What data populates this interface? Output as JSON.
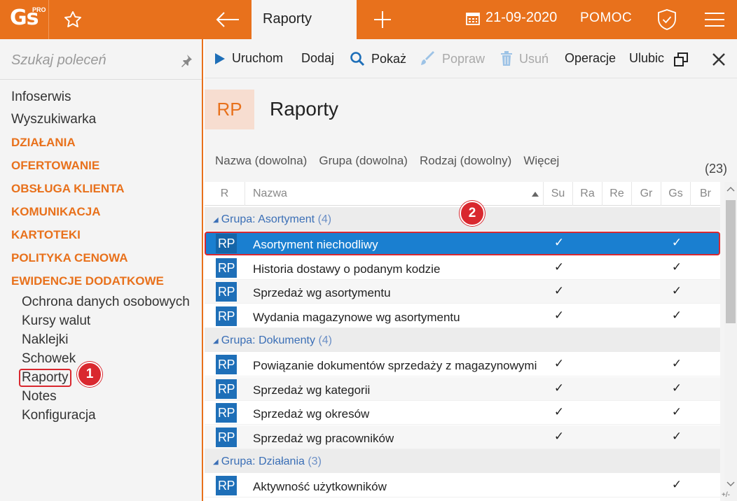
{
  "app": {
    "logo_text": "Gs",
    "logo_sup": "PRO",
    "active_tab": "Raporty",
    "date": "21-09-2020",
    "help": "POMOC"
  },
  "sidebar": {
    "search_placeholder": "Szukaj poleceń",
    "items": [
      {
        "label": "Infoserwis"
      },
      {
        "label": "Wyszukiwarka"
      },
      {
        "label": "DZIAŁANIA"
      },
      {
        "label": "OFERTOWANIE"
      },
      {
        "label": "OBSŁUGA KLIENTA"
      },
      {
        "label": "KOMUNIKACJA"
      },
      {
        "label": "KARTOTEKI"
      },
      {
        "label": "POLITYKA CENOWA"
      },
      {
        "label": "EWIDENCJE DODATKOWE"
      }
    ],
    "subitems": [
      {
        "label": "Ochrona danych osobowych"
      },
      {
        "label": "Kursy walut"
      },
      {
        "label": "Naklejki"
      },
      {
        "label": "Schowek"
      },
      {
        "label": "Raporty"
      },
      {
        "label": "Notes"
      },
      {
        "label": "Konfiguracja"
      }
    ],
    "badge": "1"
  },
  "toolbar": {
    "run": "Uruchom",
    "add": "Dodaj",
    "show": "Pokaż",
    "edit": "Popraw",
    "delete": "Usuń",
    "operations": "Operacje",
    "favorites": "Ulubic"
  },
  "main": {
    "icon_text": "RP",
    "title": "Raporty",
    "filters": [
      "Nazwa (dowolna)",
      "Grupa (dowolna)",
      "Rodzaj (dowolny)",
      "Więcej"
    ],
    "count": "(23)",
    "badge": "2"
  },
  "grid": {
    "columns": [
      "R",
      "Nazwa",
      "Su",
      "Ra",
      "Re",
      "Gr",
      "Gs",
      "Br"
    ],
    "check": "✓",
    "groups": [
      {
        "prefix": "Grupa:",
        "name": "Asortyment",
        "count": "(4)"
      },
      {
        "prefix": "Grupa:",
        "name": "Dokumenty",
        "count": "(4)"
      },
      {
        "prefix": "Grupa:",
        "name": "Działania",
        "count": "(3)"
      }
    ],
    "rows": [
      {
        "icon": "RP",
        "name": "Asortyment niechodliwy"
      },
      {
        "icon": "RP",
        "name": "Historia dostawy o podanym kodzie"
      },
      {
        "icon": "RP",
        "name": "Sprzedaż wg asortymentu"
      },
      {
        "icon": "RP",
        "name": "Wydania magazynowe wg asortymentu"
      },
      {
        "icon": "RP",
        "name": "Powiązanie dokumentów sprzedaży z magazynowymi"
      },
      {
        "icon": "RP",
        "name": "Sprzedaż wg kategorii"
      },
      {
        "icon": "RP",
        "name": "Sprzedaż wg okresów"
      },
      {
        "icon": "RP",
        "name": "Sprzedaż wg pracowników"
      },
      {
        "icon": "RP",
        "name": "Aktywność użytkowników"
      }
    ],
    "footer": "+/-"
  },
  "colors": {
    "accent": "#e8711c",
    "selection": "#1a7fd0",
    "highlight": "#d9282f",
    "group_text": "#3b6fb6"
  }
}
